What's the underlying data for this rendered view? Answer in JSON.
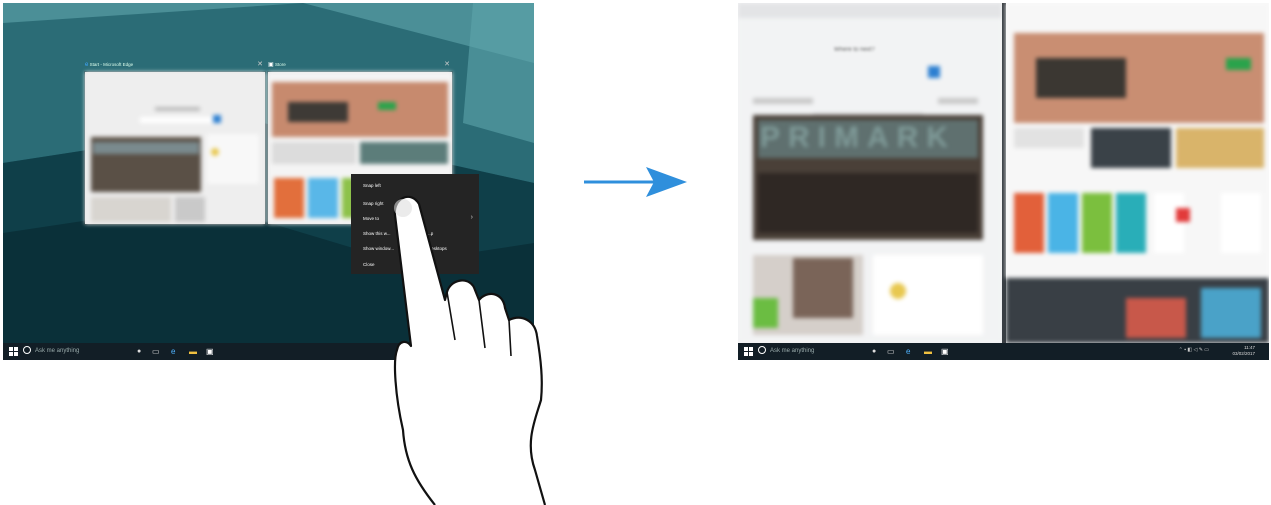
{
  "left_screen": {
    "windows": [
      {
        "title": "Start - Microsoft Edge"
      },
      {
        "title": "Store"
      }
    ],
    "context_menu": {
      "items": [
        "Snap left",
        "Snap right",
        "Move to",
        "Show this w...",
        "Show window...",
        "Close"
      ],
      "fragments": [
        "...p",
        "...desktops"
      ]
    },
    "taskbar": {
      "search_placeholder": "Ask me anything"
    }
  },
  "right_screen": {
    "left_app": {
      "heading": "Where to next?",
      "banner_text": "PRIMARK"
    },
    "taskbar": {
      "search_placeholder": "Ask me anything",
      "time": "11:47",
      "date": "03/02/2017"
    }
  },
  "colors": {
    "arrow": "#2f8fdc",
    "taskbar": "#121e26",
    "wallpaper_dark": "#0d3b45",
    "wallpaper_light": "#4b8f97",
    "context_menu_bg": "#242424"
  },
  "icons": [
    "windows-logo-icon",
    "cortana-icon",
    "microphone-icon",
    "task-view-icon",
    "edge-icon",
    "file-explorer-icon",
    "store-icon",
    "close-icon",
    "chevron-right-icon",
    "arrow-right-icon",
    "hand-pointer-icon"
  ]
}
